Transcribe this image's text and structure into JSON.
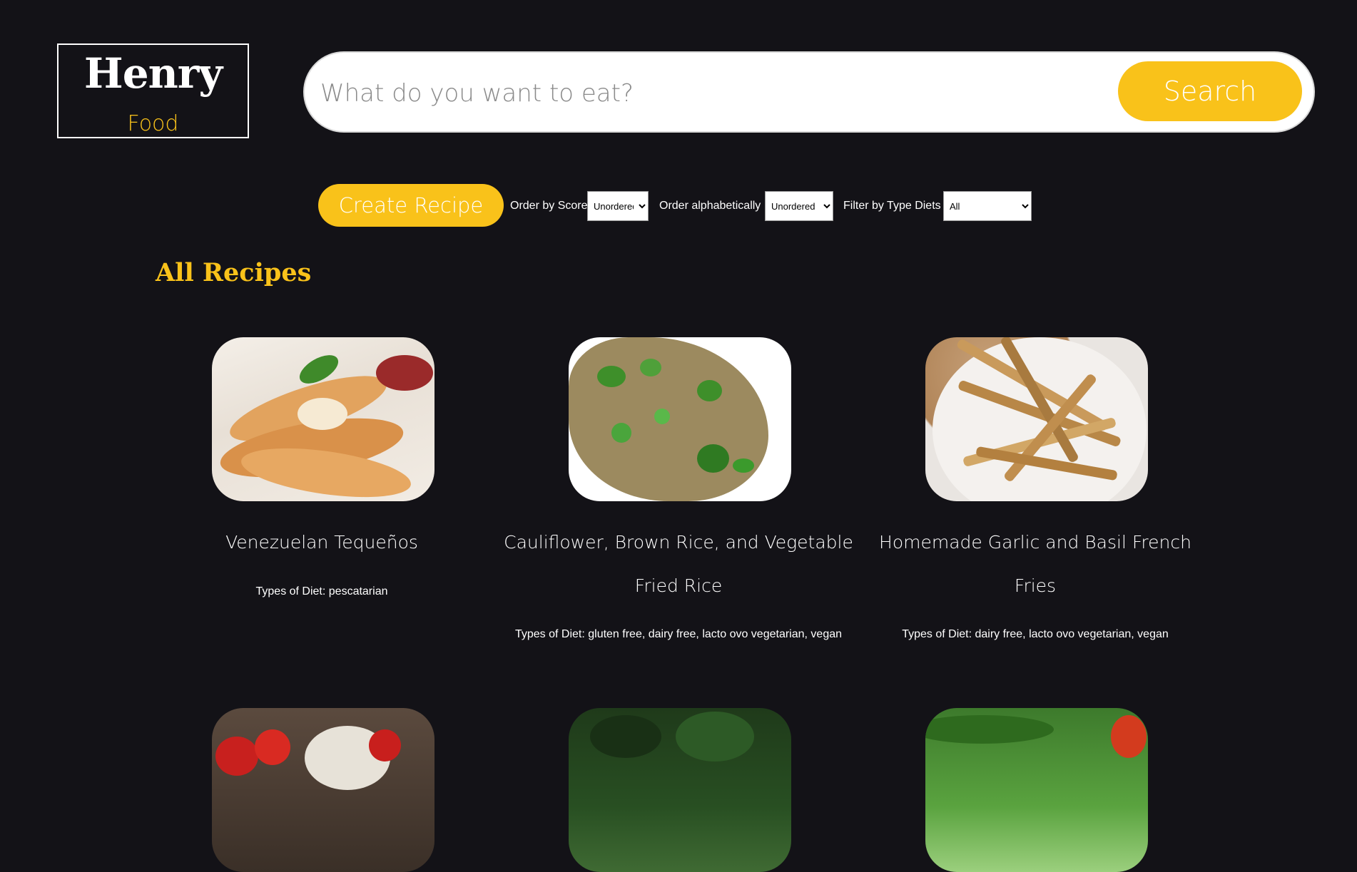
{
  "logo": {
    "title": "Henry",
    "subtitle": "Food"
  },
  "search": {
    "placeholder": "What do you want to eat?",
    "button_label": "Search"
  },
  "toolbar": {
    "create_label": "Create Recipe",
    "order_score_label": "Order by Score",
    "order_score_value": "Unordered",
    "order_alpha_label": "Order alphabetically",
    "order_alpha_value": "Unordered",
    "filter_diet_label": "Filter by Type Diets",
    "filter_diet_value": "All"
  },
  "section": {
    "title": "All Recipes"
  },
  "recipes": [
    {
      "title": "Venezuelan Tequeños",
      "diets": "Types of Diet: pescatarian",
      "image": "tequenos-photo"
    },
    {
      "title": "Cauliflower, Brown Rice, and Vegetable Fried Rice",
      "diets": "Types of Diet: gluten free, dairy free, lacto ovo vegetarian, vegan",
      "image": "fried-rice-photo"
    },
    {
      "title": "Homemade Garlic and Basil French Fries",
      "diets": "Types of Diet: dairy free, lacto ovo vegetarian, vegan",
      "image": "french-fries-photo"
    },
    {
      "image": "strawberries-photo"
    },
    {
      "image": "greens-photo"
    },
    {
      "image": "green-onions-photo"
    }
  ],
  "colors": {
    "background": "#131217",
    "accent": "#f9c21a",
    "text": "#ffffff"
  }
}
